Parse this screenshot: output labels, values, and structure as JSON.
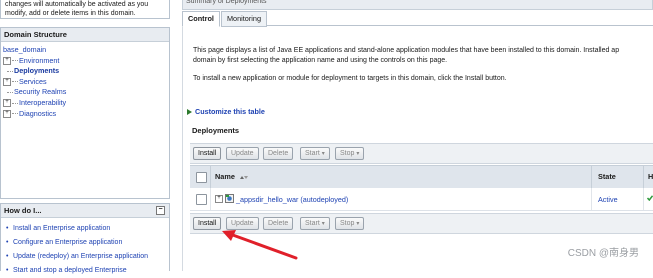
{
  "left": {
    "change_center_text_line1": "changes will automatically be activated as you",
    "change_center_text_line2": "modify, add or delete items in this domain.",
    "domain_structure": {
      "title": "Domain Structure",
      "items": [
        {
          "label": "base_domain",
          "prefix": "",
          "bold": false
        },
        {
          "label": "Environment",
          "prefix": "+",
          "bold": false
        },
        {
          "label": "Deployments",
          "prefix": "line",
          "bold": true
        },
        {
          "label": "Services",
          "prefix": "+",
          "bold": false
        },
        {
          "label": "Security Realms",
          "prefix": "line",
          "bold": false
        },
        {
          "label": "Interoperability",
          "prefix": "+",
          "bold": false
        },
        {
          "label": "Diagnostics",
          "prefix": "+",
          "bold": false
        }
      ]
    },
    "how_do_i": {
      "title": "How do I...",
      "minimize": "−",
      "items": [
        "Install an Enterprise application",
        "Configure an Enterprise application",
        "Update (redeploy) an Enterprise application",
        "Start and stop a deployed Enterprise"
      ]
    }
  },
  "main": {
    "summary_title": "Summary of Deployments",
    "tabs": [
      {
        "label": "Control",
        "active": true
      },
      {
        "label": "Monitoring",
        "active": false
      }
    ],
    "description_line1": "This page displays a list of Java EE applications and stand-alone application modules that have been installed to this domain. Installed ap",
    "description_line2": "domain by first selecting the application name and using the controls on this page.",
    "install_instruction": "To install a new application or module for deployment to targets in this domain, click the Install button.",
    "customize_link": "Customize this table",
    "deployments_title": "Deployments",
    "buttons": {
      "install": "Install",
      "update": "Update",
      "delete": "Delete",
      "start": "Start",
      "stop": "Stop",
      "caret": "▾"
    },
    "table": {
      "col_name": "Name",
      "col_state": "State",
      "col_health": "H",
      "rows": [
        {
          "expander": "+",
          "name": "_appsdir_hello_war (autodeployed)",
          "state": "Active"
        }
      ]
    }
  },
  "watermark": "CSDN @南身男",
  "colors": {
    "link": "#1f43b3",
    "arrow": "#e0202a",
    "header_bg": "#dfe5ec"
  }
}
